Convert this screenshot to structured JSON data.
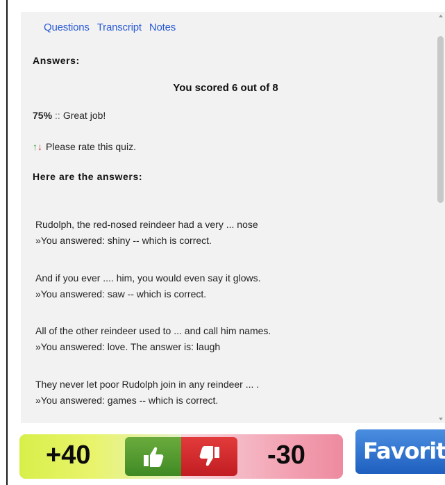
{
  "tabs": [
    {
      "label": "Questions"
    },
    {
      "label": "Transcript"
    },
    {
      "label": "Notes"
    }
  ],
  "answers_heading": "Answers:",
  "score_text": "You scored 6 out of 8",
  "percent": {
    "value": "75%",
    "separator": "::",
    "message": "Great job!"
  },
  "rate": {
    "up_arrow": "↑",
    "down_arrow": "↓",
    "text": "Please rate this quiz."
  },
  "here_heading": "Here are the answers:",
  "answers": [
    {
      "question": "Rudolph, the red-nosed reindeer had a very ... nose",
      "response": "»You answered: shiny -- which is correct."
    },
    {
      "question": "And if you ever .... him, you would even say it glows.",
      "response": "»You answered: saw -- which is correct."
    },
    {
      "question": "All of the other reindeer used to ... and call him names.",
      "response": "»You answered: love. The answer is: laugh"
    },
    {
      "question": "They never let poor Rudolph join in any reindeer ... .",
      "response": "»You answered: games -- which is correct."
    }
  ],
  "rating_bar": {
    "plus_score": "+40",
    "minus_score": "-30",
    "thumb_up_icon": "thumbs-up-icon",
    "thumb_down_icon": "thumbs-down-icon"
  },
  "favorite_label": "Favorite",
  "colors": {
    "link": "#2a5bd4",
    "panel_bg": "#f2f2f2",
    "thumb_up": "#4f9a2c",
    "thumb_down": "#d12a2e",
    "favorite": "#2c6fd1"
  }
}
